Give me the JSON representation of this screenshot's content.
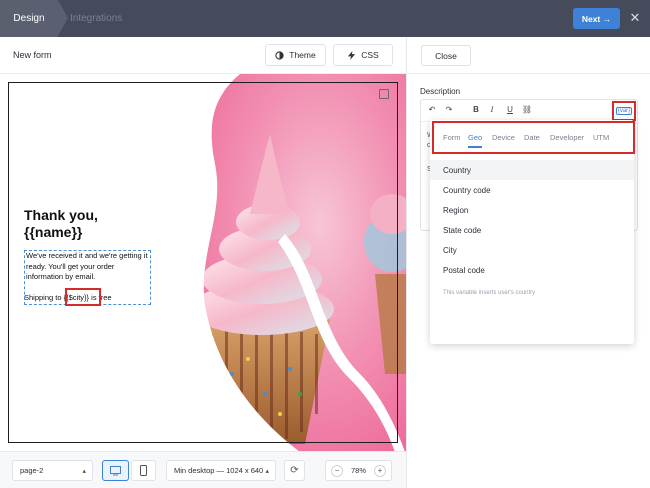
{
  "topbar": {
    "tab_design": "Design",
    "tab_integrations": "Integrations",
    "next_label": "Next →",
    "close_symbol": "✕"
  },
  "subheader": {
    "form_name": "New form",
    "theme_label": "Theme",
    "css_label": "CSS"
  },
  "popup": {
    "title_line1": "Thank you,",
    "title_line2": "{{name}}",
    "body": "We've received it and we're getting it ready. You'll get your order information by email.",
    "shipping_prefix": "Shipping to ",
    "shipping_var": "{{$city}}",
    "shipping_suffix": " is free"
  },
  "bottombar": {
    "page_select": "page-2",
    "device_select": "Min desktop — 1024 x 640",
    "zoom_minus": "−",
    "zoom_value": "78%",
    "zoom_plus": "+"
  },
  "rightpanel": {
    "close_label": "Close",
    "description_label": "Description",
    "var_button": "{var}",
    "var_tabs": [
      "Form",
      "Geo",
      "Device",
      "Date",
      "Developer",
      "UTM"
    ],
    "active_tab": "Geo",
    "var_items": [
      "Country",
      "Country code",
      "Region",
      "State code",
      "City",
      "Postal code"
    ],
    "var_note": "This variable inserts user's country"
  },
  "colors": {
    "accent": "#3d82d6",
    "highlight": "#d72b2b",
    "topbar": "#454b5a",
    "pink": "#f06b9a"
  },
  "icons": [
    "theme-icon",
    "lightning-icon",
    "undo-icon",
    "redo-icon",
    "bold-icon",
    "italic-icon",
    "underline-icon",
    "link-icon",
    "desktop-icon",
    "mobile-icon",
    "refresh-icon",
    "close-icon",
    "corner-icon"
  ]
}
